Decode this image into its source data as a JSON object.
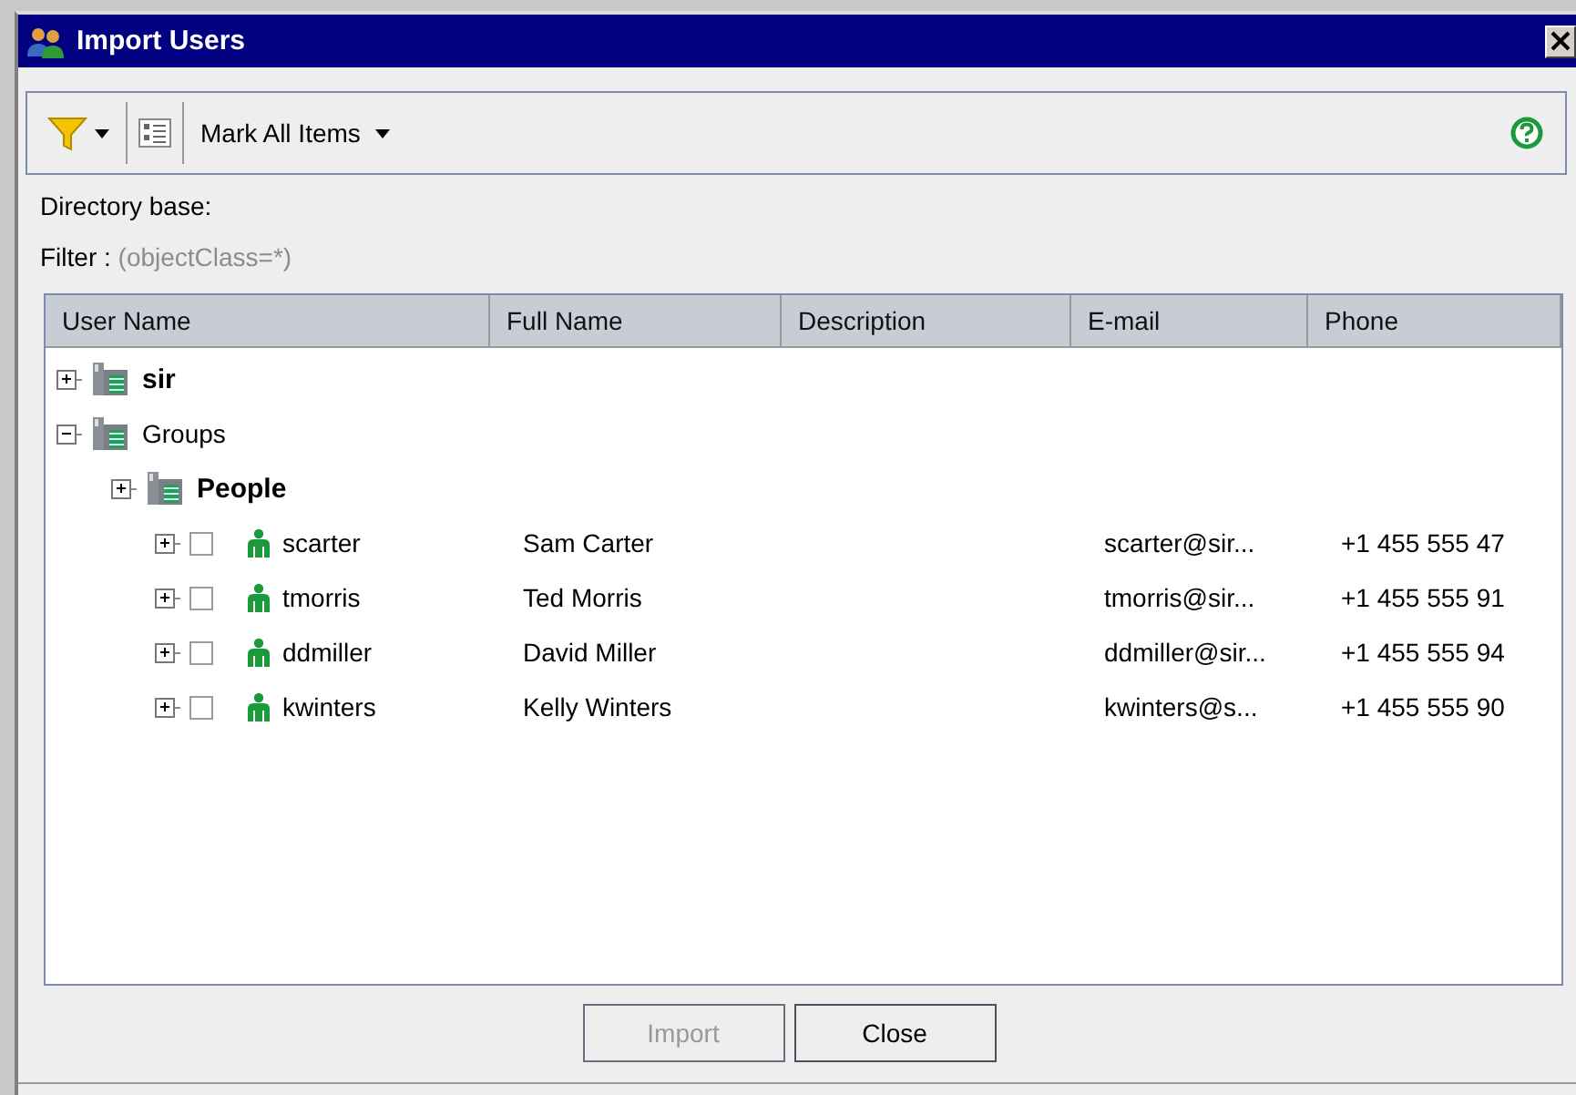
{
  "window": {
    "title": "Import Users"
  },
  "toolbar": {
    "mark_menu": "Mark All Items"
  },
  "directory_base": {
    "label": "Directory base:"
  },
  "filter": {
    "label": "Filter :",
    "value": "(objectClass=*)"
  },
  "table": {
    "columns": [
      "User Name",
      "Full Name",
      "Description",
      "E-mail",
      "Phone"
    ],
    "tree": [
      {
        "kind": "directory",
        "label": "sir",
        "bold": true,
        "expanded": false
      },
      {
        "kind": "directory",
        "label": "Groups",
        "bold": false,
        "expanded": true,
        "children": [
          {
            "kind": "directory",
            "label": "People",
            "bold": true,
            "expanded": false,
            "children": [
              {
                "kind": "user",
                "label": "scarter",
                "checked": false,
                "expanded": false,
                "full_name": "Sam Carter",
                "email": "scarter@sir...",
                "phone": "+1 455 555 47"
              },
              {
                "kind": "user",
                "label": "tmorris",
                "checked": false,
                "expanded": false,
                "full_name": "Ted Morris",
                "email": "tmorris@sir...",
                "phone": "+1 455 555 91"
              },
              {
                "kind": "user",
                "label": "ddmiller",
                "checked": false,
                "expanded": false,
                "full_name": "David Miller",
                "email": "ddmiller@sir...",
                "phone": "+1 455 555 94"
              },
              {
                "kind": "user",
                "label": "kwinters",
                "checked": false,
                "expanded": false,
                "full_name": "Kelly Winters",
                "email": "kwinters@s...",
                "phone": "+1 455 555 90"
              }
            ]
          }
        ]
      }
    ]
  },
  "buttons": [
    {
      "label": "Import",
      "disabled": true
    },
    {
      "label": "Close",
      "disabled": false
    }
  ]
}
